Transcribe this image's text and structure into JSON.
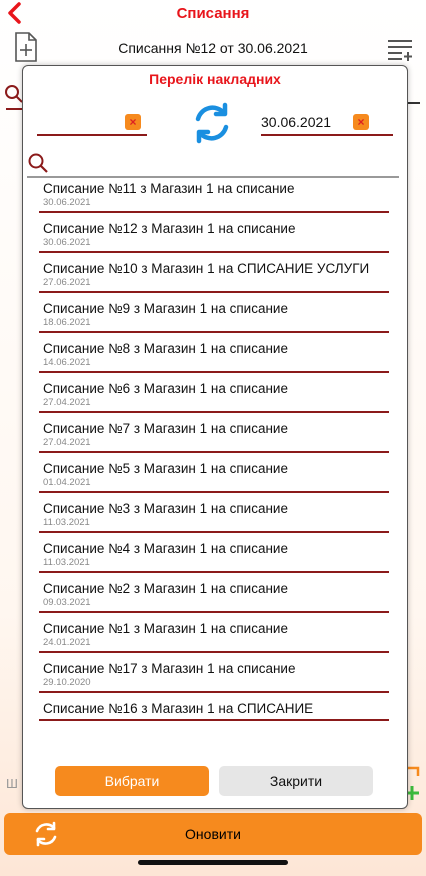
{
  "nav": {
    "title": "Списання"
  },
  "header": {
    "doc_title": "Списання №12 от 30.06.2021"
  },
  "dialog": {
    "title": "Перелік накладних",
    "date_from": "",
    "date_to": "30.06.2021",
    "search_placeholder": "",
    "items": [
      {
        "title": "Списание №11 з Магазин 1 на списание",
        "date": "30.06.2021"
      },
      {
        "title": "Списание №12 з Магазин 1 на списание",
        "date": "30.06.2021"
      },
      {
        "title": "Списание №10 з Магазин 1 на СПИСАНИЕ УСЛУГИ",
        "date": "27.06.2021"
      },
      {
        "title": "Списание №9 з Магазин 1 на списание",
        "date": "18.06.2021"
      },
      {
        "title": "Списание №8 з Магазин 1 на списание",
        "date": "14.06.2021"
      },
      {
        "title": "Списание №6 з Магазин 1 на списание",
        "date": "27.04.2021"
      },
      {
        "title": "Списание №7 з Магазин 1 на списание",
        "date": "27.04.2021"
      },
      {
        "title": "Списание №5 з Магазин 1 на списание",
        "date": "01.04.2021"
      },
      {
        "title": "Списание №3 з Магазин 1 на списание",
        "date": "11.03.2021"
      },
      {
        "title": "Списание №4 з Магазин 1 на списание",
        "date": "11.03.2021"
      },
      {
        "title": "Списание №2 з Магазин 1 на списание",
        "date": "09.03.2021"
      },
      {
        "title": "Списание №1 з Магазин 1 на списание",
        "date": "24.01.2021"
      },
      {
        "title": "Списание №17 з Магазин 1 на списание",
        "date": "29.10.2020"
      },
      {
        "title": "Списание №16 з Магазин 1 на СПИСАНИЕ",
        "date": ""
      }
    ],
    "select_label": "Вибрати",
    "close_label": "Закрити"
  },
  "footer": {
    "refresh_label": "Оновити"
  },
  "background": {
    "letter": "Ш"
  },
  "colors": {
    "accent": "#f68a1e",
    "title_red": "#e8151b",
    "divider": "#8b1a1a",
    "sync_blue": "#1a8fe0"
  },
  "icons": [
    "back-icon",
    "doc-add-icon",
    "list-add-icon",
    "sync-icon",
    "search-icon",
    "clear-icon",
    "refresh-icon"
  ]
}
